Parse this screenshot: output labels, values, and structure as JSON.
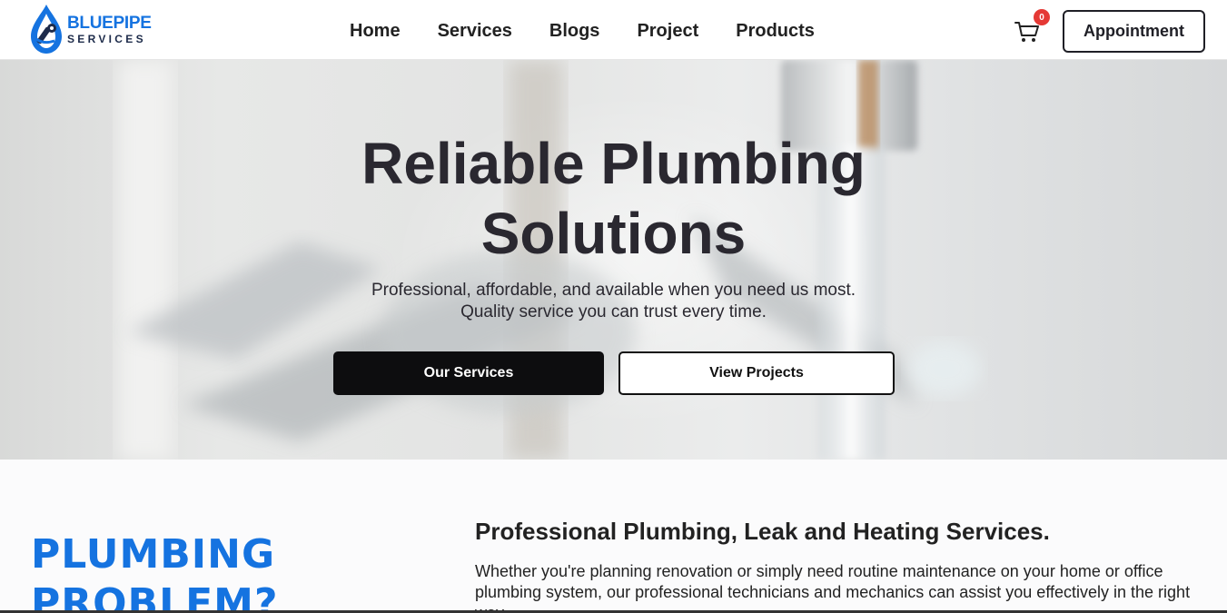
{
  "brand": {
    "name": "BLUEPIPE",
    "sub": "SERVICES",
    "accent": "#1573e0"
  },
  "nav": {
    "items": [
      "Home",
      "Services",
      "Blogs",
      "Project",
      "Products"
    ]
  },
  "cart": {
    "icon": "cart-icon",
    "count": "0"
  },
  "header": {
    "appointment_label": "Appointment"
  },
  "hero": {
    "title_line1": "Reliable Plumbing",
    "title_line2": "Solutions",
    "subtitle_line1": "Professional, affordable, and available when you need us most.",
    "subtitle_line2": "Quality service you can trust every time.",
    "primary_button": "Our Services",
    "secondary_button": "View Projects"
  },
  "section": {
    "problem_line1": "PLUMBING",
    "problem_line2": "PROBLEM?",
    "heading": "Professional Plumbing, Leak and Heating Services.",
    "body": "Whether you're planning renovation or simply need routine maintenance on your home or office plumbing system, our professional technicians and mechanics can assist you effectively in the right way."
  },
  "colors": {
    "dark": "#0d0d0f",
    "badge": "#e53935"
  }
}
